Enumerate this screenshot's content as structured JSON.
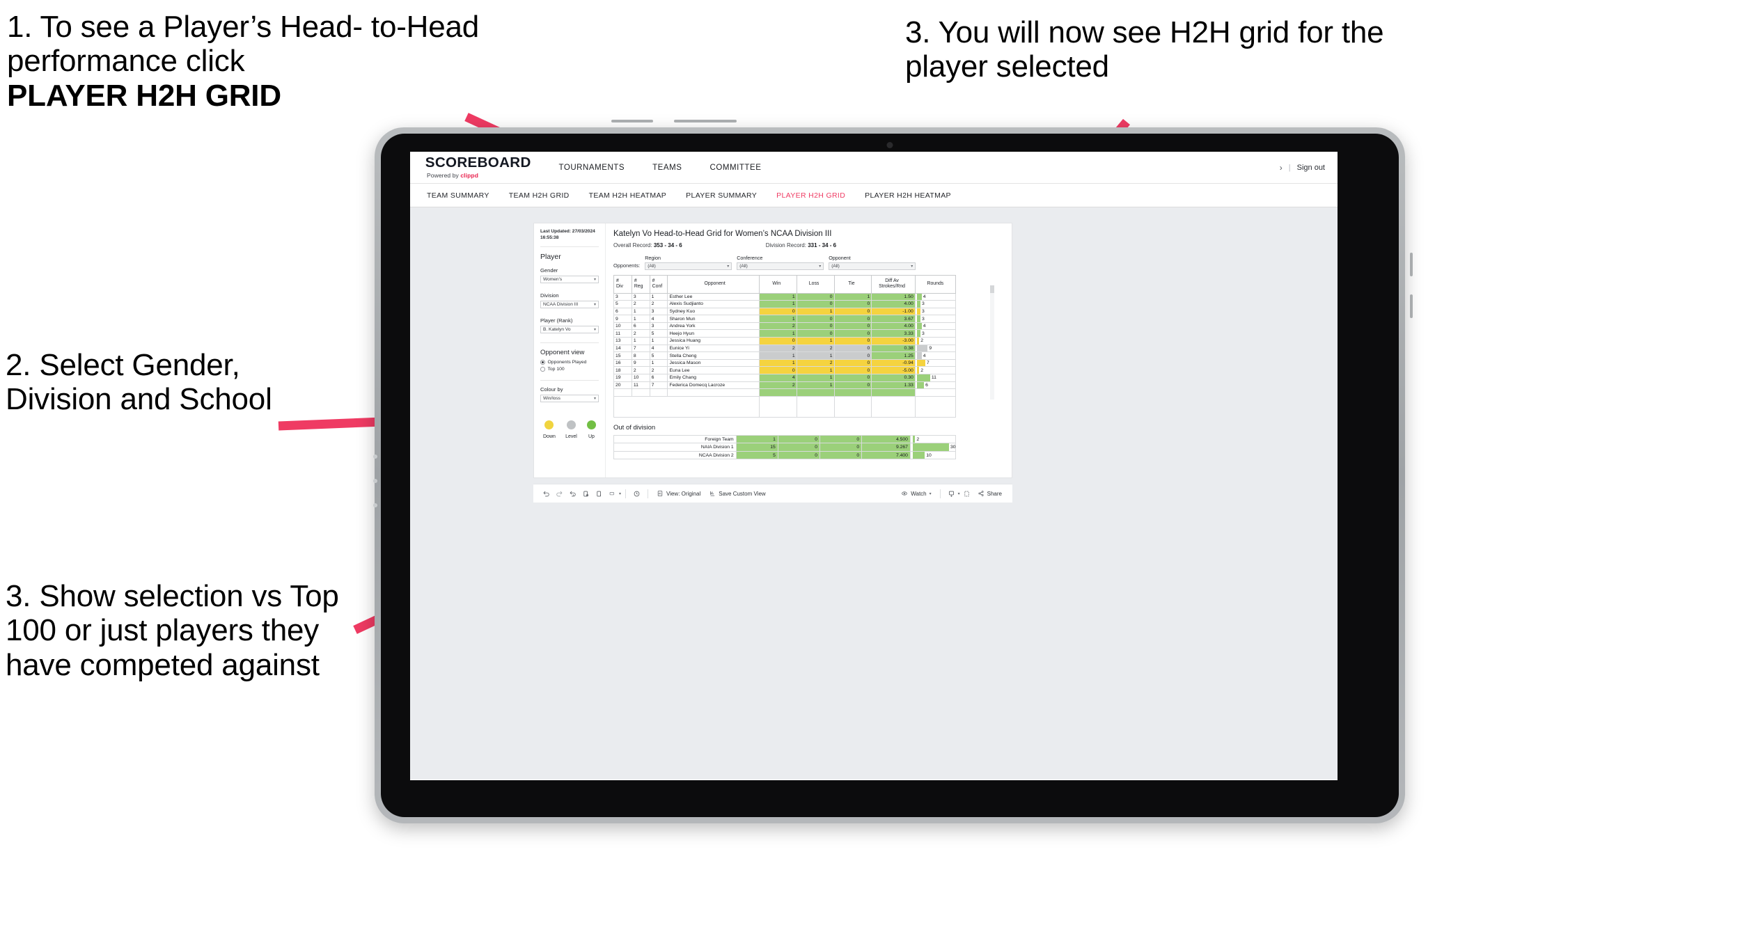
{
  "annotations": {
    "a1_line1": "1. To see a Player’s Head-",
    "a1_line2": "to-Head performance click",
    "a1_bold": "PLAYER H2H GRID",
    "a2": "2. Select Gender, Division and School",
    "a3": "3. Show selection vs Top 100 or just players they have competed against",
    "a4": "3. You will now see H2H grid for the player selected"
  },
  "header": {
    "brand_name": "SCOREBOARD",
    "brand_sub_prefix": "Powered by ",
    "brand_sub_brand": "clippd",
    "nav": [
      "TOURNAMENTS",
      "TEAMS",
      "COMMITTEE"
    ],
    "chevron": "›",
    "separator": "|",
    "sign_out": "Sign out",
    "accent_color": "#e9234f"
  },
  "subnav": {
    "items": [
      {
        "label": "TEAM SUMMARY",
        "active": false
      },
      {
        "label": "TEAM H2H GRID",
        "active": false
      },
      {
        "label": "TEAM H2H HEATMAP",
        "active": false
      },
      {
        "label": "PLAYER SUMMARY",
        "active": false
      },
      {
        "label": "PLAYER H2H GRID",
        "active": true
      },
      {
        "label": "PLAYER H2H HEATMAP",
        "active": false
      }
    ],
    "active_color": "#ef3b63"
  },
  "sidebar": {
    "last_updated": "Last Updated: 27/03/2024 16:55:38",
    "player_section_title": "Player",
    "gender_label": "Gender",
    "gender_value": "Women's",
    "division_label": "Division",
    "division_value": "NCAA Division III",
    "player_label": "Player (Rank)",
    "player_value": "B. Katelyn Vo",
    "opponent_view_title": "Opponent view",
    "opponent_view_options": [
      {
        "label": "Opponents Played",
        "selected": true
      },
      {
        "label": "Top 100",
        "selected": false
      }
    ],
    "colour_by_label": "Colour by",
    "colour_by_value": "Win/loss",
    "legend": [
      {
        "label": "Down",
        "color": "#f0d43f"
      },
      {
        "label": "Level",
        "color": "#bfc2c4"
      },
      {
        "label": "Up",
        "color": "#72bf44"
      }
    ]
  },
  "viz": {
    "title": "Katelyn Vo Head-to-Head Grid for Women’s NCAA Division III",
    "overall_record_label": "Overall Record:",
    "overall_record_value": "353 -  34 - 6",
    "division_record_label": "Division Record:",
    "division_record_value": "331 -  34 - 6",
    "opponents_label": "Opponents:",
    "filters": [
      {
        "label": "Region",
        "value": "(All)"
      },
      {
        "label": "Conference",
        "value": "(All)"
      },
      {
        "label": "Opponent",
        "value": "(All)"
      }
    ],
    "columns": [
      "# Div",
      "# Reg",
      "# Conf",
      "Opponent",
      "Win",
      "Loss",
      "Tie",
      "Diff Av Strokes/Rnd",
      "Rounds"
    ],
    "column_headers_split": [
      {
        "l1": "#",
        "l2": "Div"
      },
      {
        "l1": "#",
        "l2": "Reg"
      },
      {
        "l1": "#",
        "l2": "Conf"
      },
      {
        "l1": "Opponent",
        "l2": ""
      },
      {
        "l1": "Win",
        "l2": ""
      },
      {
        "l1": "Loss",
        "l2": ""
      },
      {
        "l1": "Tie",
        "l2": ""
      },
      {
        "l1": "Diff Av",
        "l2": "Strokes/Rnd"
      },
      {
        "l1": "Rounds",
        "l2": ""
      }
    ],
    "out_of_division_title": "Out of division"
  },
  "chart_data": {
    "type": "table",
    "title": "Katelyn Vo Head-to-Head Grid for Women’s NCAA Division III",
    "columns": [
      "# Div",
      "# Reg",
      "# Conf",
      "Opponent",
      "Win",
      "Loss",
      "Tie",
      "Diff Av Strokes/Rnd",
      "Rounds"
    ],
    "colour_by": "Win/loss",
    "colour_scale": {
      "Down": "#f0d43f",
      "Level": "#bfc2c4",
      "Up": "#72bf44"
    },
    "rounds_axis_max": 30,
    "rows": [
      {
        "div": "3",
        "reg": "3",
        "conf": "1",
        "opponent": "Esther Lee",
        "win": "1",
        "loss": "0",
        "tie": "1",
        "diff": "1.50",
        "rounds": 4,
        "state": "up"
      },
      {
        "div": "5",
        "reg": "2",
        "conf": "2",
        "opponent": "Alexis Sudjianto",
        "win": "1",
        "loss": "0",
        "tie": "0",
        "diff": "4.00",
        "rounds": 3,
        "state": "up"
      },
      {
        "div": "6",
        "reg": "1",
        "conf": "3",
        "opponent": "Sydney Kuo",
        "win": "0",
        "loss": "1",
        "tie": "0",
        "diff": "-1.00",
        "rounds": 3,
        "state": "down"
      },
      {
        "div": "9",
        "reg": "1",
        "conf": "4",
        "opponent": "Sharon Mun",
        "win": "1",
        "loss": "0",
        "tie": "0",
        "diff": "3.67",
        "rounds": 3,
        "state": "up"
      },
      {
        "div": "10",
        "reg": "6",
        "conf": "3",
        "opponent": "Andrea York",
        "win": "2",
        "loss": "0",
        "tie": "0",
        "diff": "4.00",
        "rounds": 4,
        "state": "up"
      },
      {
        "div": "11",
        "reg": "2",
        "conf": "5",
        "opponent": "Heejo Hyun",
        "win": "1",
        "loss": "0",
        "tie": "0",
        "diff": "3.33",
        "rounds": 3,
        "state": "up"
      },
      {
        "div": "13",
        "reg": "1",
        "conf": "1",
        "opponent": "Jessica Huang",
        "win": "0",
        "loss": "1",
        "tie": "0",
        "diff": "-3.00",
        "rounds": 2,
        "state": "down"
      },
      {
        "div": "14",
        "reg": "7",
        "conf": "4",
        "opponent": "Eunice Yi",
        "win": "2",
        "loss": "2",
        "tie": "0",
        "diff": "0.38",
        "rounds": 9,
        "state": "level",
        "diff_state": "up"
      },
      {
        "div": "15",
        "reg": "8",
        "conf": "5",
        "opponent": "Stella Cheng",
        "win": "1",
        "loss": "1",
        "tie": "0",
        "diff": "1.25",
        "rounds": 4,
        "state": "level",
        "diff_state": "up"
      },
      {
        "div": "16",
        "reg": "9",
        "conf": "1",
        "opponent": "Jessica Mason",
        "win": "1",
        "loss": "2",
        "tie": "0",
        "diff": "-0.94",
        "rounds": 7,
        "state": "down"
      },
      {
        "div": "18",
        "reg": "2",
        "conf": "2",
        "opponent": "Euna Lee",
        "win": "0",
        "loss": "1",
        "tie": "0",
        "diff": "-5.00",
        "rounds": 2,
        "state": "down"
      },
      {
        "div": "19",
        "reg": "10",
        "conf": "6",
        "opponent": "Emily Chang",
        "win": "4",
        "loss": "1",
        "tie": "0",
        "diff": "0.30",
        "rounds": 11,
        "state": "up"
      },
      {
        "div": "20",
        "reg": "11",
        "conf": "7",
        "opponent": "Federica Domecq Lacroze",
        "win": "2",
        "loss": "1",
        "tie": "0",
        "diff": "1.33",
        "rounds": 6,
        "state": "up"
      }
    ],
    "out_of_division_rows": [
      {
        "name": "Foreign Team",
        "win": "1",
        "loss": "0",
        "tie": "0",
        "diff": "4.500",
        "rounds": 2,
        "state": "up"
      },
      {
        "name": "NAIA Division 1",
        "win": "15",
        "loss": "0",
        "tie": "0",
        "diff": "9.267",
        "rounds": 30,
        "state": "up"
      },
      {
        "name": "NCAA Division 2",
        "win": "5",
        "loss": "0",
        "tie": "0",
        "diff": "7.400",
        "rounds": 10,
        "state": "up"
      }
    ]
  },
  "toolbar": {
    "view_label": "View: Original",
    "save_label": "Save Custom View",
    "watch_label": "Watch",
    "share_label": "Share",
    "caret": "▾"
  }
}
